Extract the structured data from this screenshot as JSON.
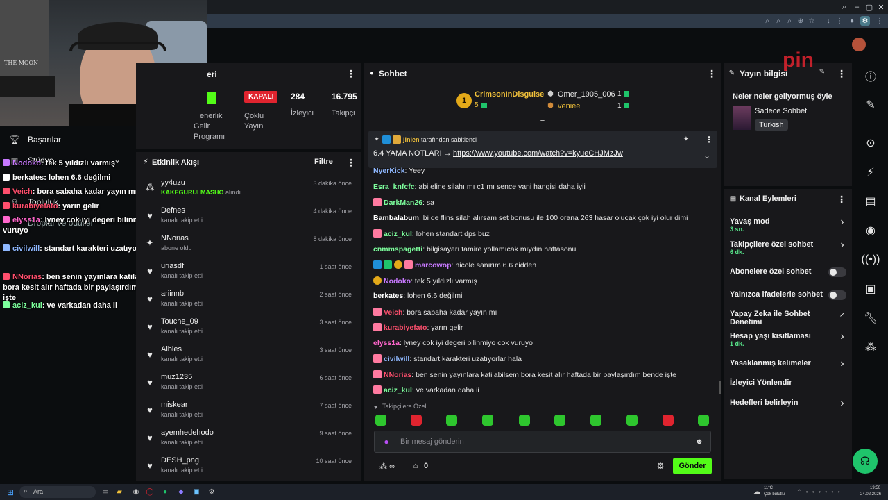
{
  "webcam": {
    "poster_text": "THE MOON"
  },
  "overlay_chat": [
    {
      "user": "Nodoko",
      "color": "#c879ff",
      "text": ": tek 5 yıldızlı varmış"
    },
    {
      "user": "berkates",
      "color": "#ffffff",
      "text": ": lohen 6.6 değilmi"
    },
    {
      "user": "Veich",
      "color": "#ff4f6d",
      "text": ": bora sabaha kadar yayın mı"
    },
    {
      "user": "kurabiyefato",
      "color": "#ff4f6d",
      "text": ": yarın gelir"
    },
    {
      "user": "elyss1a",
      "color": "#ff66cc",
      "text": ": lyney cok iyi degeri bilinmiyo cok vuruyo"
    },
    {
      "user": "civilwill",
      "color": "#8fb8ff",
      "text": ": standart karakteri uzatıyorlar hala"
    },
    {
      "user": "NNorias",
      "color": "#ff4f6d",
      "text": ": ben senin yayınlara katilabilsem bora kesit alır haftada bir paylaşırdım bende işte"
    },
    {
      "user": "aciz_kul",
      "color": "#7dff9d",
      "text": ": ve varkadan daha ii"
    }
  ],
  "left_nav": {
    "achievements": "Başarılar",
    "studio": "Stüdyo",
    "community": "Topluluk",
    "drops": "Droplar ve ödüller"
  },
  "stats": {
    "title_partial": "eri",
    "status_badge": "KAPALI",
    "partner_label_lines": [
      "Ortaklık",
      "Gelir",
      "Programı"
    ],
    "partner_cut": "enerlik",
    "multi_stream": [
      "Çoklu",
      "Yayın"
    ],
    "viewers_value": "284",
    "viewers_label": "İzleyici",
    "followers_value": "16.795",
    "followers_label": "Takipçi"
  },
  "activity": {
    "title": "Etkinlik Akışı",
    "filter": "Filtre",
    "items": [
      {
        "name": "yy4uzu",
        "sub": "KAKEGURUI MASHO",
        "sub_suffix": " alındı",
        "time": "3 dakika önce",
        "icon": "gift-icon"
      },
      {
        "name": "Defnes",
        "sub": "kanalı takip etti",
        "time": "4 dakika önce",
        "icon": "heart-icon"
      },
      {
        "name": "NNorias",
        "sub": "abone oldu",
        "time": "8 dakika önce",
        "icon": "star-icon"
      },
      {
        "name": "uriasdf",
        "sub": "kanalı takip etti",
        "time": "1 saat önce",
        "icon": "heart-icon"
      },
      {
        "name": "ariinnb",
        "sub": "kanalı takip etti",
        "time": "2 saat önce",
        "icon": "heart-icon"
      },
      {
        "name": "Touche_09",
        "sub": "kanalı takip etti",
        "time": "3 saat önce",
        "icon": "heart-icon"
      },
      {
        "name": "Albies",
        "sub": "kanalı takip etti",
        "time": "3 saat önce",
        "icon": "heart-icon"
      },
      {
        "name": "muz1235",
        "sub": "kanalı takip etti",
        "time": "6 saat önce",
        "icon": "heart-icon"
      },
      {
        "name": "miskear",
        "sub": "kanalı takip etti",
        "time": "7 saat önce",
        "icon": "heart-icon"
      },
      {
        "name": "ayemhedehodo",
        "sub": "kanalı takip etti",
        "time": "9 saat önce",
        "icon": "heart-icon"
      },
      {
        "name": "DESH_png",
        "sub": "kanalı takip etti",
        "time": "10 saat önce",
        "icon": "heart-icon"
      }
    ]
  },
  "chat": {
    "title": "Sohbet",
    "top_gifters": [
      {
        "name": "CrimsonInDisguise",
        "count": "5",
        "rank": "1"
      },
      {
        "name": "Omer_1905_006",
        "count": "1"
      },
      {
        "name": "veniee",
        "count": "1"
      }
    ],
    "pinned": {
      "pinned_by": "jinien",
      "pinned_by_suffix": " tarafından sabitlendi",
      "text": "6.4 YAMA NOTLARI → ",
      "link": "https://www.youtube.com/watch?v=kyueCHJMzJw"
    },
    "messages": [
      {
        "user": "NyerKick",
        "color": "#8fb8ff",
        "text": ": Yeey",
        "badges": []
      },
      {
        "user": "Esra_knfcfc",
        "color": "#7dff9d",
        "text": ": abi eline silahı mı c1 mı sence yani hangisi daha iyii",
        "badges": []
      },
      {
        "user": "DarkMan26",
        "color": "#7dff9d",
        "text": ": sa",
        "badges": [
          "sub"
        ]
      },
      {
        "user": "Bambalabum",
        "color": "#ffffff",
        "text": ": bi de flins silah alırsam set bonusu ile 100 orana 263 hasar olucak çok iyi olur dimi",
        "badges": []
      },
      {
        "user": "aciz_kul",
        "color": "#7dff9d",
        "text": ": lohen standart dps buz",
        "badges": [
          "sub"
        ]
      },
      {
        "user": "cnmmspagetti",
        "color": "#7dff9d",
        "text": ": bilgisayarı tamire yollamıcak mıydın haftasonu",
        "badges": []
      },
      {
        "user": "marcowop",
        "color": "#c879ff",
        "text": ": nicole sanırım 6.6 cidden",
        "badges": [
          "mod",
          "vip",
          "gift",
          "sub"
        ]
      },
      {
        "user": "Nodoko",
        "color": "#c879ff",
        "text": ": tek 5 yıldızlı varmış",
        "badges": [
          "gift"
        ]
      },
      {
        "user": "berkates",
        "color": "#ffffff",
        "text": ": lohen 6.6 değilmi",
        "badges": []
      },
      {
        "user": "Veich",
        "color": "#ff4f6d",
        "text": ": bora sabaha kadar yayın mı",
        "badges": [
          "sub"
        ]
      },
      {
        "user": "kurabiyefato",
        "color": "#ff4f6d",
        "text": ": yarın gelir",
        "badges": [
          "sub"
        ]
      },
      {
        "user": "elyss1a",
        "color": "#ff66cc",
        "text": ": lyney cok iyi degeri bilinmiyo cok vuruyo",
        "badges": []
      },
      {
        "user": "civilwill",
        "color": "#8fb8ff",
        "text": ": standart karakteri uzatıyorlar hala",
        "badges": [
          "sub"
        ]
      },
      {
        "user": "NNorias",
        "color": "#ff4f6d",
        "text": ": ben senin yayınlara katilabilsem bora kesit alır haftada bir paylaşırdım bende işte",
        "badges": [
          "sub"
        ]
      },
      {
        "user": "aciz_kul",
        "color": "#7dff9d",
        "text": ": ve varkadan daha ii",
        "badges": [
          "sub"
        ]
      }
    ],
    "followers_only": "Takipçilere Özel",
    "input_placeholder": "Bir mesaj gönderin",
    "points": "0",
    "send": "Gönder"
  },
  "stream_info": {
    "title": "Yayın bilgisi",
    "stream_title": "Neler neler geliyormuş öyle",
    "category": "Sadece Sohbet",
    "tag": "Turkish",
    "logo_text": "pin"
  },
  "channel_actions": {
    "title": "Kanal Eylemleri",
    "items": [
      {
        "label": "Yavaş mod",
        "sub": "3 sn.",
        "control": "chevron"
      },
      {
        "label": "Takipçilere özel sohbet",
        "sub": "6 dk.",
        "control": "chevron"
      },
      {
        "label": "Abonelere özel sohbet",
        "sub": "",
        "control": "toggle"
      },
      {
        "label": "Yalnızca ifadelerle sohbet",
        "sub": "",
        "control": "toggle"
      },
      {
        "label": "Yapay Zeka ile Sohbet Denetimi",
        "sub": "",
        "control": "external"
      },
      {
        "label": "Hesap yaşı kısıtlaması",
        "sub": "1 dk.",
        "control": "chevron"
      },
      {
        "label": "Yasaklanmış kelimeler",
        "sub": "",
        "control": "chevron"
      },
      {
        "label": "İzleyici Yönlendir",
        "sub": "",
        "control": "none"
      },
      {
        "label": "Hedefleri belirleyin",
        "sub": "",
        "control": "chevron"
      }
    ]
  },
  "taskbar": {
    "search": "Ara",
    "weather_temp": "11°C",
    "weather_desc": "Çok bulutlu",
    "time": "19:50",
    "date": "24.02.2026"
  },
  "colors": {
    "accent_green": "#53fc18",
    "panel_bg": "#18181b",
    "status_red": "#e0242f",
    "badge_green": "#1fc46b"
  }
}
